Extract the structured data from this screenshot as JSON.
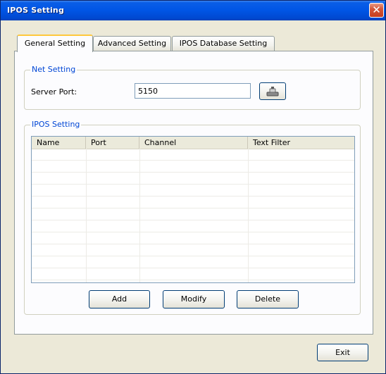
{
  "window": {
    "title": "IPOS Setting",
    "close_glyph": "✕"
  },
  "tabs": [
    {
      "label": "General Setting",
      "active": true
    },
    {
      "label": "Advanced Setting",
      "active": false
    },
    {
      "label": "IPOS Database Setting",
      "active": false
    }
  ],
  "net_setting": {
    "title": "Net Setting",
    "server_port_label": "Server Port:",
    "server_port_value": "5150",
    "icon": "keyboard-icon"
  },
  "ipos_setting": {
    "title": "IPOS Setting",
    "columns": [
      "Name",
      "Port",
      "Channel",
      "Text Filter"
    ],
    "rows": [],
    "add_label": "Add",
    "modify_label": "Modify",
    "delete_label": "Delete"
  },
  "footer": {
    "exit_label": "Exit"
  }
}
